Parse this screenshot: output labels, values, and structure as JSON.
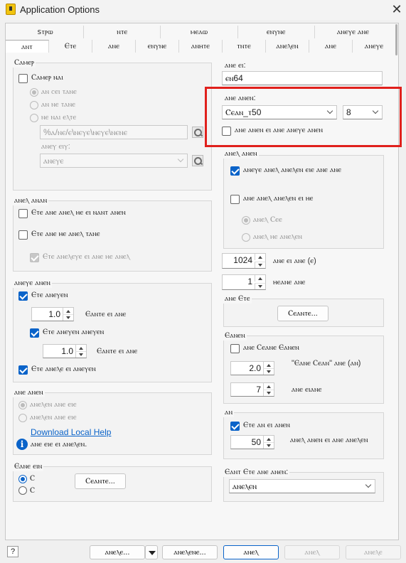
{
  "window": {
    "title": "Application Options",
    "close_glyph": "✕"
  },
  "tabs_top": [
    "ꜱⲧⲣⲱ",
    "ⲛⲧⲉ",
    "ⲙⲉⲁⲱ",
    "ⲉⲛⲩⲛⲉ",
    "ⲁⲛⲉⲩⲉ ⲁⲛⲉ"
  ],
  "tabs_bottom": [
    "ⲁⲛⲧ",
    "Ⲉⲧⲉ",
    "ⲁⲛⲉ",
    "ⲉⲛⲩⲛⲉ",
    "ⲁⲛⲏⲧⲉ",
    "ⲧⲛⲧⲉ",
    "ⲁⲛⲉⲗⲉⲛ",
    "ⲁⲛⲉ",
    "ⲁⲛⲉⲩⲉ"
  ],
  "left": {
    "group1": {
      "title": "Ⲥⲁⲙⲉⲣ",
      "main_check": "Ⲥⲁⲙⲉⲣ ⲛⲁⲓ",
      "radios": [
        "ⲁⲛ ⲥⲉⲓ ⲧⲁⲛⲉ",
        "ⲁⲛ ⲛⲉ ⲧⲁⲛⲉ",
        "ⲛⲉ ⲛⲁⲓ ⲉⲗⲧⲉ"
      ],
      "path": "%ⲁ/ⲛⲉ/ⲉ\\ⲛⲉⲩⲉ\\ⲛⲉⲩⲉ\\ⲛⲉⲛⲉ",
      "sub_label": "ⲁⲛⲉⲩ ⲉⲓⲩ:",
      "sub_select": "ⲁⲛⲉⲩⲉ"
    },
    "group2": {
      "title": "ⲁⲛⲉⲗ ⲁⲛⲁⲛ",
      "checks": [
        "Ⲉⲧⲉ ⲁⲛⲉ ⲁⲛⲉⲗ ⲏⲉ ⲉⲓ ⲛⲁⲛⲧ ⲁⲛⲉⲛ",
        "Ⲉⲧⲉ ⲁⲛⲉ ⲏⲉ ⲁⲛⲉⲗ ⲧⲁⲛⲉ",
        "Ⲉⲧⲉ ⲁⲛⲉⲗⲉⲩⲉ ⲉⲓ ⲁⲛⲉ ⲏⲉ ⲁⲛⲉⲗ"
      ]
    },
    "group3": {
      "title": "ⲁⲛⲉⲩⲉ ⲁⲛⲉⲛ",
      "check1": "Ⲉⲧⲉ ⲁⲛⲉⲩⲉⲛ",
      "val1": "1.0",
      "val1_label": "Ⲉⲁⲛⲧⲉ ⲉⲓ ⲁⲛⲉ",
      "check2": "Ⲉⲧⲉ ⲁⲛⲉⲩⲉⲛ ⲁⲛⲉⲩⲉⲛ",
      "val2": "1.0",
      "val2_label": "Ⲉⲁⲛⲧⲉ ⲉⲓ ⲁⲛⲉ",
      "check3": "Ⲉⲧⲉ ⲁⲛⲉⲗⲉ ⲉⲓ ⲁⲛⲉⲩⲉⲛ"
    },
    "group4": {
      "title": "ⲁⲛⲉ ⲁⲛⲉⲛ",
      "radios": [
        "ⲁⲛⲉⲗⲉⲛ ⲁⲛⲉ ⲉⲓⲉ",
        "ⲁⲛⲉⲗⲉⲛ ⲁⲛⲉ ⲉⲓⲉ"
      ],
      "link": "Download Local Help",
      "info_text": "ⲁⲛⲉ ⲉⲓⲉ ⲉⲓ ⲁⲛⲉⲗⲉⲛ."
    },
    "group5": {
      "title": "Ⲉⲁⲛⲉ ⲉⲓⲛ",
      "radio1": "Ⲥ",
      "radio2": "Ⲥ",
      "button": "Ⲥⲉⲁⲛⲧⲉ..."
    }
  },
  "right": {
    "top_label": "ⲁⲛⲉ ⲉⲓ:",
    "top_value": "ⲉⲛ64",
    "font_group": {
      "label": "ⲁⲛⲉ ⲁⲛⲉⲛ:",
      "font_select": "Ⲥⲉⲁⲛ_ⲧ50",
      "size_select": "8",
      "check": "ⲁⲛⲉ ⲁⲛⲉⲛ ⲉⲓ ⲁⲛⲉ ⲁⲛⲉⲩⲉ ⲁⲛⲉⲛ"
    },
    "groupA": {
      "title": "ⲁⲛⲉⲗ ⲁⲛⲉⲛ",
      "check1": "ⲁⲛⲉⲩⲉ ⲁⲛⲉⲗ ⲁⲛⲉⲗⲉⲛ ⲉⲓⲉ ⲁⲛⲉ ⲁⲛⲉ",
      "check2": "ⲁⲛⲉ ⲁⲛⲉⲗ ⲁⲛⲉⲗⲉⲛ ⲉⲓ ⲏⲉ",
      "radio1": "ⲁⲛⲉⲗ Ⲥⲉⲉ",
      "radio2": "ⲁⲛⲉⲗ ⲏⲉ ⲁⲛⲉⲗⲉⲛ"
    },
    "spin1": "1024",
    "spin1_label": "ⲁⲛⲉ ⲉⲓ ⲁⲛⲉ (ⲉ)",
    "spin2": "1",
    "spin2_label": "ⲏⲉⲁⲛⲉ ⲁⲛⲉ",
    "groupB": {
      "title": "ⲁⲛⲉ Ⲉⲧⲉ",
      "button": "Ⲥⲉⲁⲛⲧⲉ..."
    },
    "groupC": {
      "title": "Ⲉⲁⲛⲉⲛ",
      "check": "ⲁⲛⲉ Ⲥⲉⲁⲛⲉ Ⲉⲁⲛⲉⲛ",
      "val1": "2.0",
      "val1_label": "\"Ⲉⲁⲛⲉ Ⲥⲉⲁⲛ\" ⲁⲛⲉ (ⲁⲛ)",
      "val2": "7",
      "val2_label": "ⲁⲛⲉ ⲉⲓⲁⲛⲉ"
    },
    "groupD": {
      "title": "ⲁⲛ",
      "check": "Ⲉⲧⲉ ⲁⲛ ⲉⲓ ⲁⲛⲉⲛ",
      "val": "50",
      "val_label": "ⲁⲛⲉⲗ ⲁⲛⲉⲛ ⲉⲓ ⲁⲛⲉ ⲁⲛⲉⲗⲉⲛ"
    },
    "groupE": {
      "title": "Ⲉⲁⲛⲧ Ⲉⲧⲉ ⲁⲛⲉ ⲁⲛⲉⲛ:",
      "select": "ⲁⲛⲉⲗⲉⲛ"
    }
  },
  "footer": {
    "help": "?",
    "btn1": "ⲁⲛⲉⲗⲉ...",
    "btn2": "ⲁⲛⲉⲗⲉⲛⲉ...",
    "btn3": "ⲁⲛⲉⲗ",
    "btn4": "ⲁⲛⲉⲗ",
    "btn5": "ⲁⲛⲉⲗⲉ"
  }
}
